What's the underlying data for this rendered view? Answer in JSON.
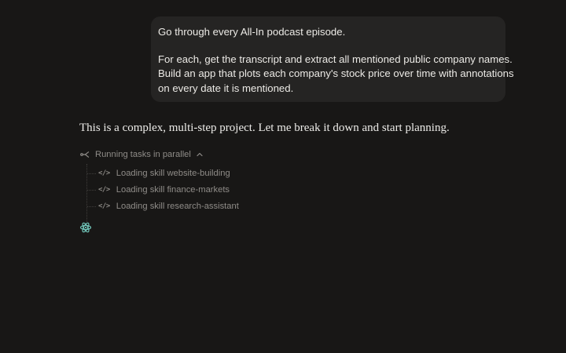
{
  "conversation": {
    "user_message": {
      "line1": "Go through every All-In podcast episode.",
      "line2": "For each, get the transcript and extract all mentioned public company names.",
      "line3": "Build an app that plots each company's stock price over time with annotations",
      "line4": "on every date it is mentioned."
    },
    "assistant_message": "This is a complex, multi-step project. Let me break it down and start planning.",
    "task_group": {
      "header_label": "Running tasks in parallel",
      "header_icon": "branch-icon",
      "toggle_icon": "chevron-up-icon",
      "items": [
        {
          "icon": "code-icon",
          "label": "Loading skill website-building"
        },
        {
          "icon": "code-icon",
          "label": "Loading skill finance-markets"
        },
        {
          "icon": "code-icon",
          "label": "Loading skill research-assistant"
        }
      ]
    },
    "status_icon": "loading-spinner-icon"
  },
  "colors": {
    "background": "#181716",
    "bubble": "#252423",
    "text": "#ecebe8",
    "muted": "#8f8c88",
    "accent": "#6fc2b6"
  }
}
